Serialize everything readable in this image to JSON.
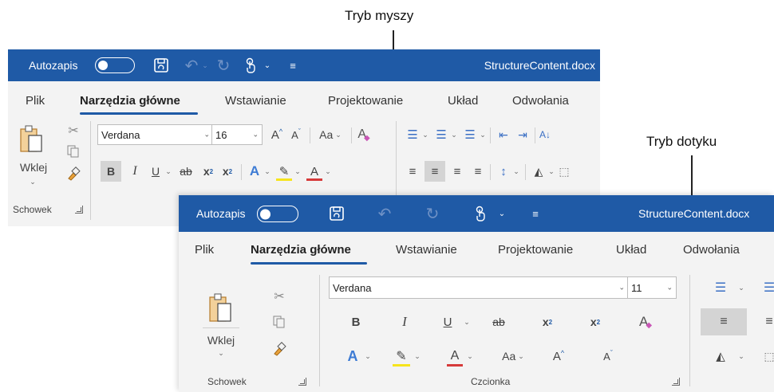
{
  "callouts": {
    "mouse_mode": "Tryb myszy",
    "touch_mode": "Tryb dotyku"
  },
  "colors": {
    "title_bar": "#1f5aa6",
    "ribbon": "#f3f3f3",
    "highlight_yellow": "#f6e41c",
    "font_red": "#d63a3a",
    "accent_blue": "#1f5aa6"
  },
  "mouse": {
    "titlebar": {
      "autosave": "Autozapis",
      "doc_name": "StructureContent.docx",
      "icons": [
        "toggle-icon",
        "save-icon",
        "undo-icon",
        "redo-icon",
        "touch-mode-icon",
        "customize-icon"
      ]
    },
    "tabs": [
      "Plik",
      "Narzędzia główne",
      "Wstawianie",
      "Projektowanie",
      "Układ",
      "Odwołania"
    ],
    "clipboard": {
      "paste": "Wklej",
      "group": "Schowek"
    },
    "font": {
      "name": "Verdana",
      "size": "16",
      "buttons": {
        "grow": "A",
        "shrink": "A",
        "case": "Aa",
        "bold": "B",
        "italic": "I",
        "underline": "U",
        "strike": "ab",
        "subscript": "x",
        "subscript_sub": "2",
        "superscript": "x",
        "superscript_sup": "2",
        "effects": "A",
        "color": "A"
      }
    }
  },
  "touch": {
    "titlebar": {
      "autosave": "Autozapis",
      "doc_name": "StructureContent.docx"
    },
    "tabs": [
      "Plik",
      "Narzędzia główne",
      "Wstawianie",
      "Projektowanie",
      "Układ",
      "Odwołania"
    ],
    "clipboard": {
      "paste": "Wklej",
      "group": "Schowek"
    },
    "font": {
      "name": "Verdana",
      "size": "11",
      "group": "Czcionka",
      "buttons": {
        "bold": "B",
        "italic": "I",
        "underline": "U",
        "strike": "ab",
        "subscript": "x",
        "subscript_sub": "2",
        "superscript": "x",
        "superscript_sup": "2",
        "effects": "A",
        "color": "A",
        "case": "Aa",
        "grow": "A",
        "shrink": "A"
      }
    }
  }
}
